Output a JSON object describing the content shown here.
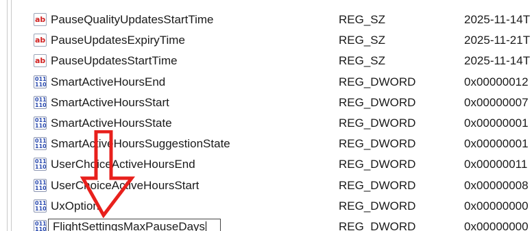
{
  "values": [
    {
      "icon": "string-value-icon",
      "name": "PauseQualityUpdatesStartTime",
      "type": "REG_SZ",
      "data": "2025-11-14T"
    },
    {
      "icon": "string-value-icon",
      "name": "PauseUpdatesExpiryTime",
      "type": "REG_SZ",
      "data": "2025-11-21T"
    },
    {
      "icon": "string-value-icon",
      "name": "PauseUpdatesStartTime",
      "type": "REG_SZ",
      "data": "2025-11-14T"
    },
    {
      "icon": "dword-value-icon",
      "name": "SmartActiveHoursEnd",
      "type": "REG_DWORD",
      "data": "0x00000012"
    },
    {
      "icon": "dword-value-icon",
      "name": "SmartActiveHoursStart",
      "type": "REG_DWORD",
      "data": "0x00000007"
    },
    {
      "icon": "dword-value-icon",
      "name": "SmartActiveHoursState",
      "type": "REG_DWORD",
      "data": "0x00000001"
    },
    {
      "icon": "dword-value-icon",
      "name": "SmartActiveHoursSuggestionState",
      "type": "REG_DWORD",
      "data": "0x00000001"
    },
    {
      "icon": "dword-value-icon",
      "name": "UserChoiceActiveHoursEnd",
      "type": "REG_DWORD",
      "data": "0x00000011"
    },
    {
      "icon": "dword-value-icon",
      "name": "UserChoiceActiveHoursStart",
      "type": "REG_DWORD",
      "data": "0x00000008"
    },
    {
      "icon": "dword-value-icon",
      "name": "UxOption",
      "type": "REG_DWORD",
      "data": "0x00000000"
    }
  ],
  "editing_row": {
    "icon": "dword-value-icon",
    "name_value": "FlightSettingsMaxPauseDays",
    "type": "REG_DWORD",
    "data": "0x00000000"
  },
  "icons": {
    "string_glyph": "ab",
    "dword_glyph_top": "011",
    "dword_glyph_bottom": "110"
  },
  "colors": {
    "arrow": "#e8201c",
    "string_icon_text": "#d02020",
    "dword_icon_text": "#2a4ab0"
  }
}
